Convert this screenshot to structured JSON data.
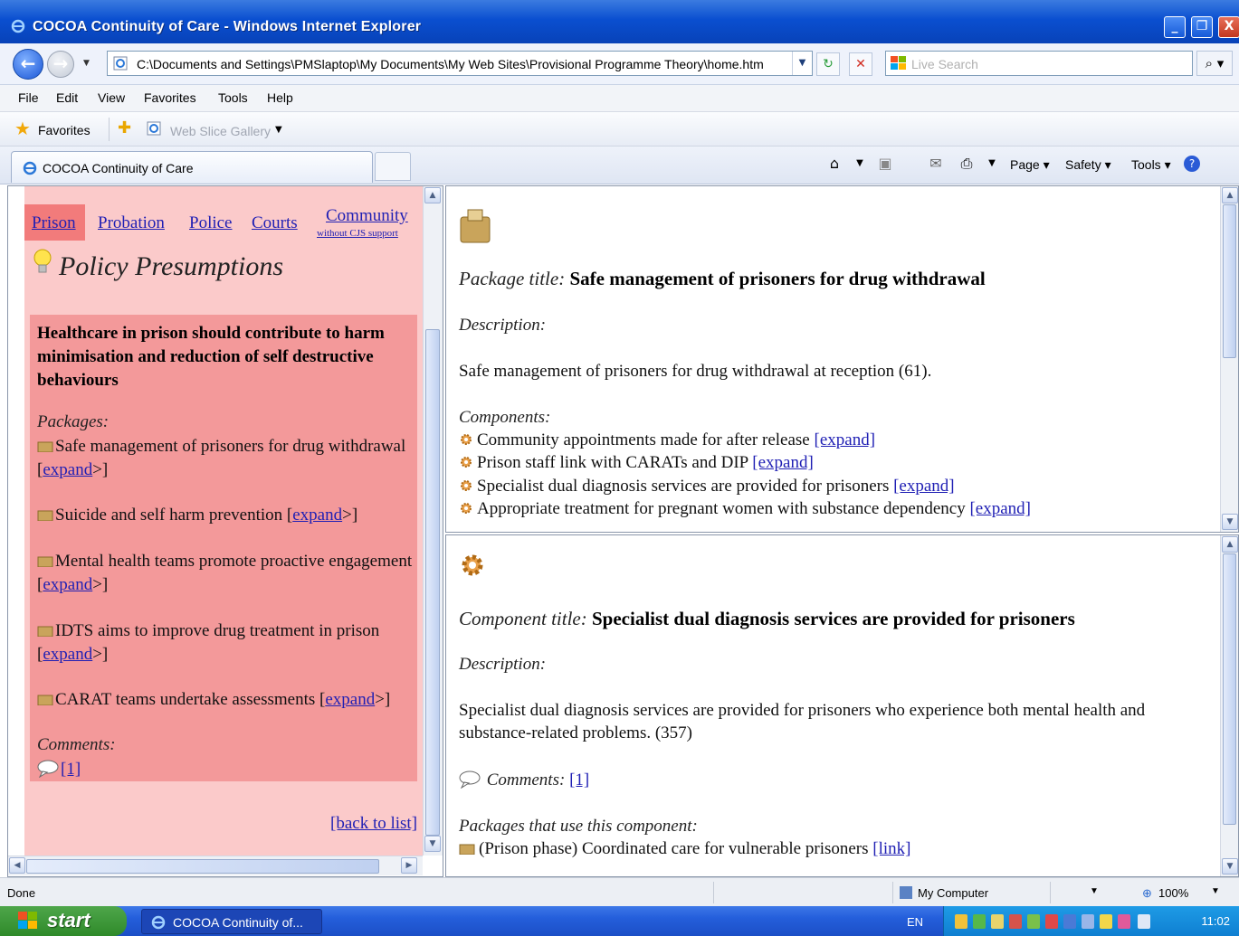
{
  "window": {
    "title": "COCOA Continuity of Care - Windows Internet Explorer",
    "minimize": "_",
    "restore": "❐",
    "close": "X"
  },
  "address": {
    "url": "C:\\Documents and Settings\\PMSlaptop\\My Documents\\My Web Sites\\Provisional Programme Theory\\home.htm",
    "search_placeholder": "Live Search"
  },
  "menu": [
    "File",
    "Edit",
    "View",
    "Favorites",
    "Tools",
    "Help"
  ],
  "favorites_bar": {
    "favorites_label": "Favorites",
    "web_slice_gallery": "Web Slice Gallery"
  },
  "tab": {
    "label": "COCOA Continuity of Care"
  },
  "command_bar": {
    "page": "Page",
    "safety": "Safety",
    "tools": "Tools"
  },
  "left": {
    "nav": {
      "prison": "Prison",
      "probation": "Probation",
      "police": "Police",
      "courts": "Courts",
      "community": "Community",
      "community_sub": "without CJS support"
    },
    "heading": "Policy Presumptions",
    "policy": "Healthcare in prison should contribute to harm minimisation and reduction of self destructive behaviours",
    "packages_label": "Packages:",
    "packages": [
      {
        "text": "Safe management of prisoners for drug withdrawal",
        "link": "expand"
      },
      {
        "text": "Suicide and self harm prevention",
        "link": "expand"
      },
      {
        "text": "Mental health teams promote proactive engagement",
        "link": "expand"
      },
      {
        "text": "IDTS aims to improve drug treatment in prison",
        "link": "expand"
      },
      {
        "text": "CARAT teams undertake assessments",
        "link": "expand"
      }
    ],
    "comments_label": "Comments:",
    "comments_link": "[1]",
    "back_to_list": "[back to list]"
  },
  "package_frame": {
    "title_label": "Package title:",
    "title": "Safe management of prisoners for drug withdrawal",
    "description_label": "Description:",
    "description": "Safe management of prisoners for drug withdrawal at reception (61).",
    "components_label": "Components:",
    "components": [
      {
        "text": "Community appointments made for after release",
        "link": "[expand]"
      },
      {
        "text": "Prison staff link with CARATs and DIP",
        "link": "[expand]"
      },
      {
        "text": "Specialist dual diagnosis services are provided for prisoners",
        "link": "[expand]"
      },
      {
        "text": "Appropriate treatment for pregnant women with substance dependency",
        "link": "[expand]"
      }
    ]
  },
  "component_frame": {
    "title_label": "Component title:",
    "title": "Specialist dual diagnosis services are provided for prisoners",
    "description_label": "Description:",
    "description_line1": "Specialist dual diagnosis services are provided for prisoners who experience both mental health and",
    "description_line2": "substance-related problems. (357)",
    "comments_label": "Comments:",
    "comments_link": "[1]",
    "packages_label": "Packages that use this component:",
    "packages": [
      {
        "text": "(Prison phase) Coordinated care for vulnerable prisoners",
        "link": "[link]"
      }
    ]
  },
  "status": {
    "text": "Done",
    "zone": "My Computer",
    "zoom": "100%"
  },
  "taskbar": {
    "start": "start",
    "task": "COCOA Continuity of...",
    "lang": "EN",
    "clock": "11:02"
  }
}
